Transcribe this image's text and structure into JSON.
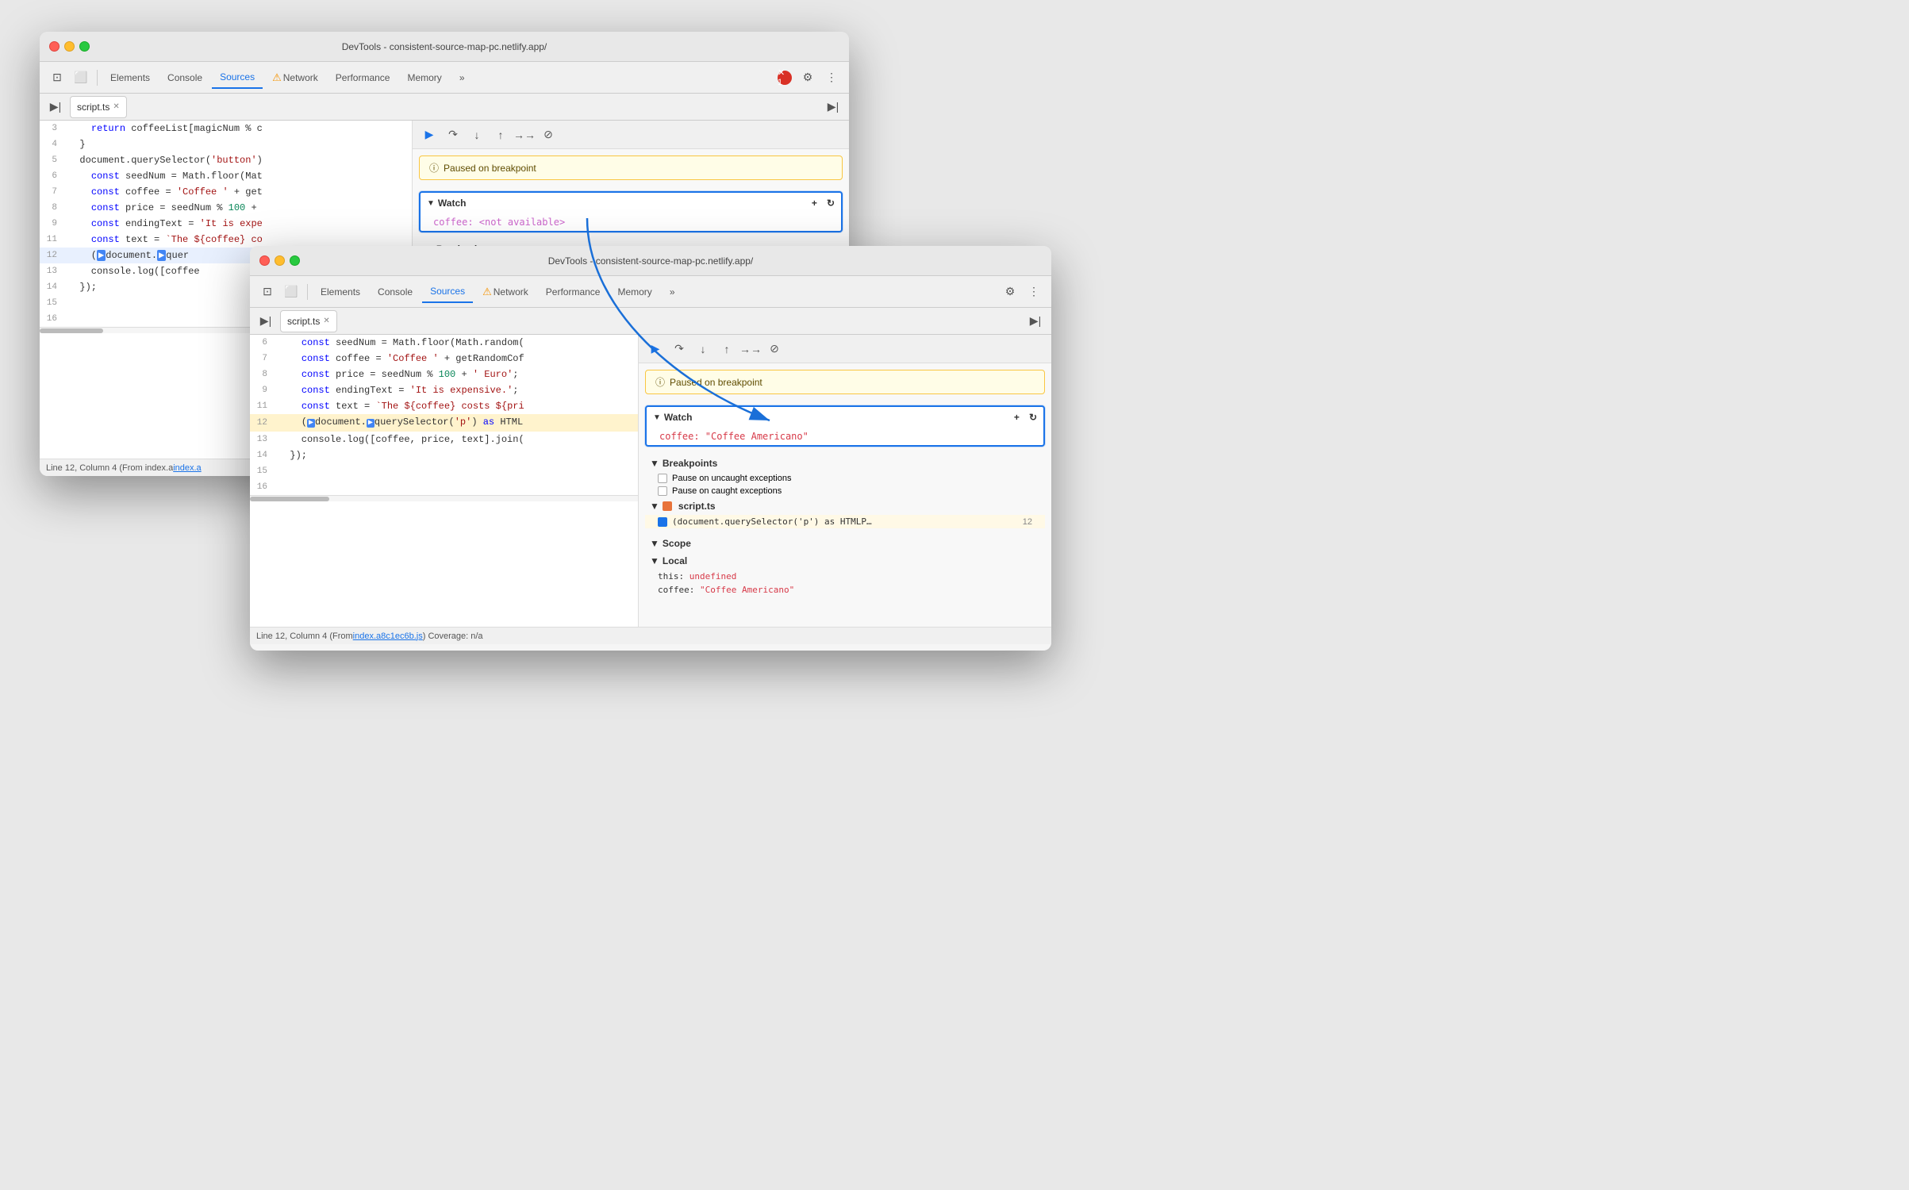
{
  "window1": {
    "title": "DevTools - consistent-source-map-pc.netlify.app/",
    "tabs": [
      "Elements",
      "Console",
      "Sources",
      "Network",
      "Performance",
      "Memory"
    ],
    "activeTab": "Sources",
    "fileTab": "script.ts",
    "code": [
      {
        "num": "3",
        "content": "    return coffeeList[magicNum % c",
        "highlight": false
      },
      {
        "num": "4",
        "content": "  }",
        "highlight": false
      },
      {
        "num": "5",
        "content": "  document.querySelector('button')",
        "highlight": false
      },
      {
        "num": "6",
        "content": "    const seedNum = Math.floor(Mat",
        "highlight": false
      },
      {
        "num": "7",
        "content": "    const coffee = 'Coffee ' + get",
        "highlight": false
      },
      {
        "num": "8",
        "content": "    const price = seedNum % 100 +",
        "highlight": false
      },
      {
        "num": "9",
        "content": "    const endingText = 'It is expe",
        "highlight": false
      },
      {
        "num": "11",
        "content": "    const text = `The ${coffee} co",
        "highlight": false
      },
      {
        "num": "12",
        "content": "    (document.querySelector",
        "highlight": true,
        "breakpoint": true
      },
      {
        "num": "13",
        "content": "    console.log([coffee",
        "highlight": false
      },
      {
        "num": "14",
        "content": "  });",
        "highlight": false
      },
      {
        "num": "15",
        "content": "",
        "highlight": false
      },
      {
        "num": "16",
        "content": "",
        "highlight": false
      }
    ],
    "pausedText": "Paused on breakpoint",
    "watchTitle": "Watch",
    "watchItem": "coffee: <not available>",
    "breakpointsTitle": "Breakpoints",
    "statusBar": "Line 12, Column 4  (From index.a",
    "statusLink": "index.a"
  },
  "window2": {
    "title": "DevTools - consistent-source-map-pc.netlify.app/",
    "tabs": [
      "Elements",
      "Console",
      "Sources",
      "Network",
      "Performance",
      "Memory"
    ],
    "activeTab": "Sources",
    "fileTab": "script.ts",
    "code": [
      {
        "num": "6",
        "content": "    const seedNum = Math.floor(Math.random(",
        "highlight": false
      },
      {
        "num": "7",
        "content": "    const coffee = 'Coffee ' + getRandomCof",
        "highlight": false
      },
      {
        "num": "8",
        "content": "    const price = seedNum % 100 + ' Euro';",
        "highlight": false
      },
      {
        "num": "9",
        "content": "    const endingText = 'It is expensive.';",
        "highlight": false
      },
      {
        "num": "11",
        "content": "    const text = `The ${coffee} costs ${pri",
        "highlight": false
      },
      {
        "num": "12",
        "content": "    (document.querySelector('p') as HTML",
        "highlight": true,
        "breakpoint": true
      },
      {
        "num": "13",
        "content": "    console.log([coffee, price, text].join(",
        "highlight": false
      },
      {
        "num": "14",
        "content": "  });",
        "highlight": false
      },
      {
        "num": "15",
        "content": "",
        "highlight": false
      },
      {
        "num": "16",
        "content": "",
        "highlight": false
      }
    ],
    "pausedText": "Paused on breakpoint",
    "watchTitle": "Watch",
    "watchItem": "coffee: \"Coffee Americano\"",
    "breakpointsTitle": "Breakpoints",
    "bpItems": [
      {
        "label": "Pause on uncaught exceptions"
      },
      {
        "label": "Pause on caught exceptions"
      }
    ],
    "bpFile": "script.ts",
    "bpCode": "(document.querySelector('p') as HTMLP…",
    "bpLine": "12",
    "scopeTitle": "Scope",
    "localTitle": "Local",
    "scopeItems": [
      {
        "key": "this:",
        "val": "undefined"
      },
      {
        "key": "coffee:",
        "val": "\"Coffee Americano\""
      }
    ],
    "statusBar": "Line 12, Column 4  (From ",
    "statusLink": "index.a8c1ec6b.js",
    "statusExtra": ") Coverage: n/a"
  },
  "arrow": {
    "color": "#1a6fd8"
  },
  "icons": {
    "inspector": "⊡",
    "device": "⬜",
    "gear": "⚙",
    "more": "⋮",
    "close": "✕",
    "resume": "▶",
    "step_over": "↷",
    "step_into": "↓",
    "step_out": "↑",
    "step_next": "→→",
    "deactivate": "⊘",
    "info": "ⓘ",
    "plus": "+",
    "refresh": "↻",
    "expand": "▶",
    "collapse": "▼",
    "warning": "⚠"
  }
}
